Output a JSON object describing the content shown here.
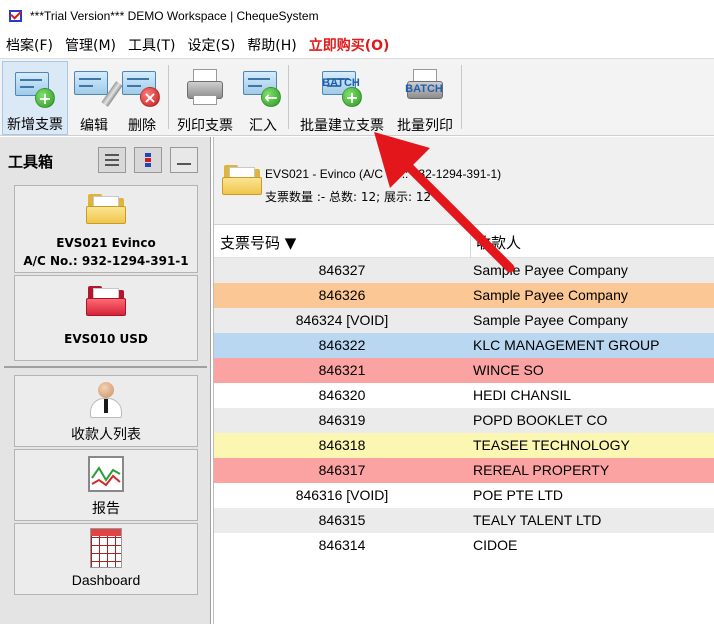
{
  "window": {
    "title": "***Trial Version*** DEMO Workspace | ChequeSystem"
  },
  "menu": {
    "items": [
      "档案(F)",
      "管理(M)",
      "工具(T)",
      "设定(S)",
      "帮助(H)"
    ],
    "buy_now": "立即购买(O)"
  },
  "toolbar": {
    "new_cheque": "新增支票",
    "edit": "编辑",
    "delete": "删除",
    "print_cheque": "列印支票",
    "import": "汇入",
    "batch_create": "批量建立支票",
    "batch_print": "批量列印",
    "batch_icon_text": "BATCH"
  },
  "sidebar": {
    "toolbox_title": "工具箱",
    "accounts": [
      {
        "line1": "EVS021 Evinco",
        "line2": "A/C No.: 932-1294-391-1",
        "folder_color": "#efc64d"
      },
      {
        "line1": "EVS010 USD",
        "folder_color": "#d6243a"
      }
    ],
    "nav": [
      "收款人列表",
      "报告",
      "Dashboard"
    ]
  },
  "account_header": {
    "line1": "EVS021 - Evinco (A/C No.: 932-1294-391-1)",
    "line2": "支票数量 :- 总数: 12; 展示: 12"
  },
  "table": {
    "columns": [
      "支票号码 ▼",
      "收款人"
    ],
    "rows": [
      {
        "number": "846327",
        "payee": "Sample Payee Company",
        "bg": "#ebebeb"
      },
      {
        "number": "846326",
        "payee": "Sample Payee Company",
        "bg": "#fbc895"
      },
      {
        "number": "846324 [VOID]",
        "payee": "Sample Payee Company",
        "bg": "#ebebeb"
      },
      {
        "number": "846322",
        "payee": "KLC MANAGEMENT GROUP",
        "bg": "#bad7f2"
      },
      {
        "number": "846321",
        "payee": "WINCE SO",
        "bg": "#fba3a3"
      },
      {
        "number": "846320",
        "payee": "HEDI CHANSIL",
        "bg": "#ffffff"
      },
      {
        "number": "846319",
        "payee": "POPD BOOKLET CO",
        "bg": "#ebebeb"
      },
      {
        "number": "846318",
        "payee": "TEASEE TECHNOLOGY",
        "bg": "#fbf6b2"
      },
      {
        "number": "846317",
        "payee": "REREAL PROPERTY",
        "bg": "#fba3a3"
      },
      {
        "number": "846316 [VOID]",
        "payee": "POE PTE LTD",
        "bg": "#ffffff"
      },
      {
        "number": "846315",
        "payee": "TEALY TALENT LTD",
        "bg": "#ebebeb"
      },
      {
        "number": "846314",
        "payee": "CIDOE",
        "bg": "#ffffff"
      }
    ]
  },
  "colors": {
    "annotation_arrow": "#e3161c",
    "buy_now": "#e01a1a"
  }
}
